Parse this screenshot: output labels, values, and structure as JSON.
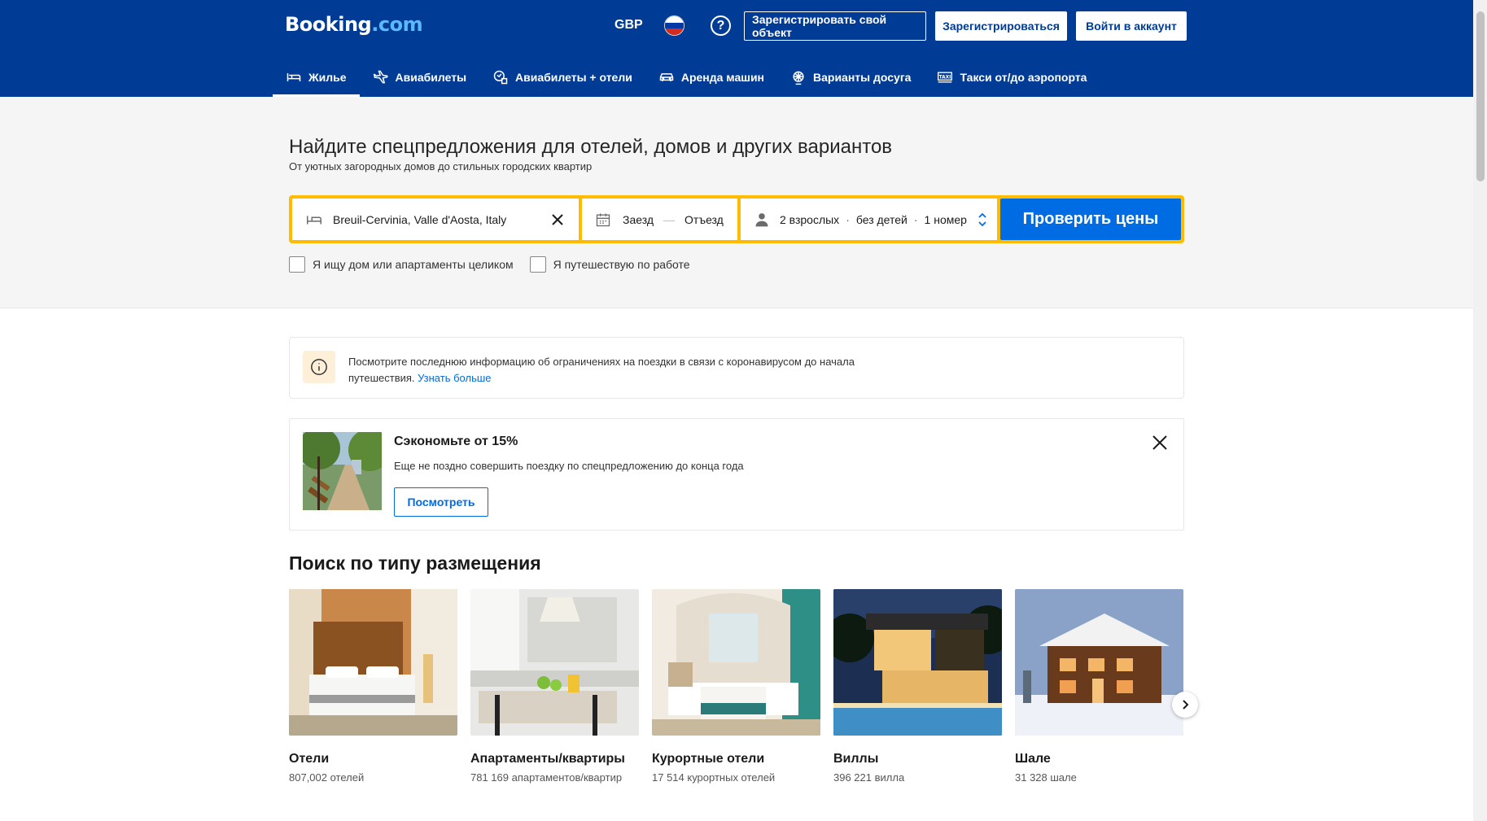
{
  "header": {
    "logo": "Booking",
    "logo_suffix": ".com",
    "currency": "GBP",
    "help_label": "?",
    "register_property": "Зарегистрировать свой объект",
    "register": "Зарегистрироваться",
    "sign_in": "Войти в аккаунт",
    "flag_colors": [
      "#ffffff",
      "#0039a6",
      "#d52b1e"
    ]
  },
  "nav": {
    "items": [
      {
        "label": "Жилье",
        "icon": "bed-icon",
        "active": true
      },
      {
        "label": "Авиабилеты",
        "icon": "plane-icon"
      },
      {
        "label": "Авиабилеты + отели",
        "icon": "plane-hotel-icon"
      },
      {
        "label": "Аренда машин",
        "icon": "car-icon"
      },
      {
        "label": "Варианты досуга",
        "icon": "attractions-icon"
      },
      {
        "label": "Такси от/до аэропорта",
        "icon": "taxi-icon"
      }
    ]
  },
  "hero": {
    "title": "Найдите спецпредложения для отелей, домов и других вариантов",
    "subtitle": "От уютных загородных домов до стильных городских квартир"
  },
  "search": {
    "destination": "Breuil-Cervinia, Valle d'Aosta, Italy",
    "check_in": "Заезд",
    "date_sep": "—",
    "check_out": "Отъезд",
    "adults": "2 взрослых",
    "children": "без детей",
    "rooms": "1 номер",
    "dot": "·",
    "button": "Проверить цены",
    "accent": "#febb02",
    "button_color": "#006ce4"
  },
  "checkboxes": {
    "whole_home": "Я ищу дом или апартаменты целиком",
    "business": "Я путешествую по работе"
  },
  "info_banner": {
    "text": "Посмотрите последнюю информацию об ограничениях на поездки в связи с коронавирусом до начала путешествия.",
    "link": "Узнать больше"
  },
  "promo": {
    "title": "Сэкономьте от 15%",
    "subtitle": "Еще не поздно совершить поездку по спецпредложению до конца года",
    "button": "Посмотреть"
  },
  "property_types": {
    "title": "Поиск по типу размещения",
    "items": [
      {
        "name": "Отели",
        "count": "807,002 отелей"
      },
      {
        "name": "Апартаменты/квартиры",
        "count": "781 169 апартаментов/квартир"
      },
      {
        "name": "Курортные отели",
        "count": "17 514 курортных отелей"
      },
      {
        "name": "Виллы",
        "count": "396 221 вилла"
      },
      {
        "name": "Шале",
        "count": "31 328 шале"
      }
    ]
  }
}
